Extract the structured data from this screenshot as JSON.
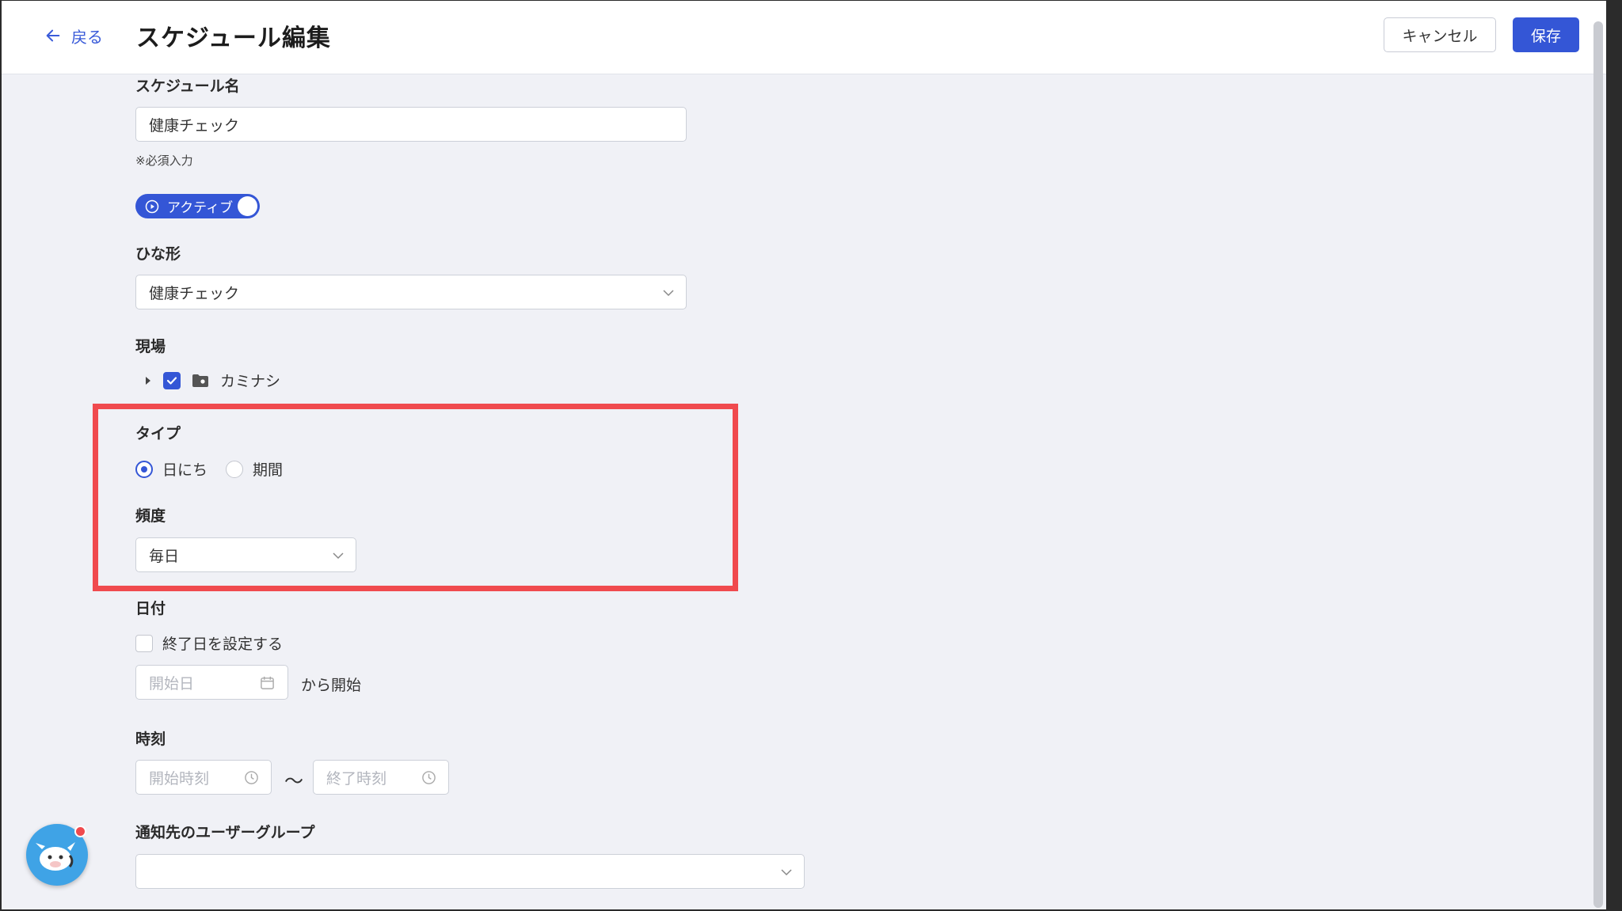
{
  "header": {
    "back_label": "戻る",
    "title": "スケジュール編集",
    "cancel_label": "キャンセル",
    "save_label": "保存"
  },
  "form": {
    "schedule_name": {
      "label": "スケジュール名",
      "value": "健康チェック",
      "hint": "※必須入力"
    },
    "active_toggle": {
      "label": "アクティブ",
      "on": true
    },
    "template": {
      "label": "ひな形",
      "value": "健康チェック"
    },
    "site": {
      "label": "現場",
      "item": "カミナシ",
      "checked": true
    },
    "type": {
      "label": "タイプ",
      "options": [
        "日にち",
        "期間"
      ],
      "selected": "日にち"
    },
    "frequency": {
      "label": "頻度",
      "value": "毎日"
    },
    "date": {
      "label": "日付",
      "set_end_date_label": "終了日を設定する",
      "start_placeholder": "開始日",
      "start_suffix": "から開始"
    },
    "time": {
      "label": "時刻",
      "start_placeholder": "開始時刻",
      "separator": "〜",
      "end_placeholder": "終了時刻"
    },
    "notify_group": {
      "label": "通知先のユーザーグループ",
      "value": ""
    }
  },
  "colors": {
    "accent": "#3456d6",
    "highlight": "#f04a4e",
    "background": "#f0f1f6"
  }
}
